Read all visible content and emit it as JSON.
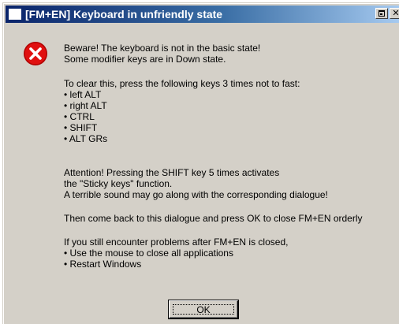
{
  "window": {
    "title": "[FM+EN] Keyboard in unfriendly state",
    "icon": "app-window-icon",
    "restore_icon": "restore-icon",
    "close_glyph": "✕"
  },
  "dialog": {
    "icon": "error-icon",
    "lines": [
      "Beware! The keyboard is not in the basic state!",
      "Some modifier keys are in Down state.",
      "To clear this, press the following keys 3 times not to fast:",
      "• left ALT",
      "• right ALT",
      "• CTRL",
      "• SHIFT",
      "• ALT GRs",
      "Attention! Pressing the SHIFT key 5 times activates",
      "the \"Sticky keys\" function.",
      "A terrible sound may go along with the corresponding dialogue!",
      "Then come back to this dialogue and press OK to close FM+EN orderly",
      "If you still encounter problems after FM+EN is closed,",
      "• Use the mouse to close all applications",
      "• Restart Windows"
    ],
    "ok_label": "OK"
  },
  "colors": {
    "titlebar_start": "#0a246a",
    "titlebar_end": "#a6caf0",
    "dialog_face": "#d4d0c8",
    "error_red": "#e01010"
  }
}
